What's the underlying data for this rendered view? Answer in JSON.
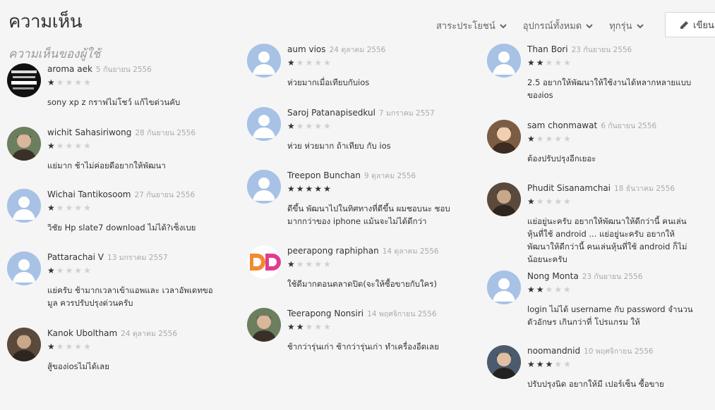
{
  "header": {
    "title": "ความเห็น",
    "filters": [
      "สาระประโยชน์",
      "อุปกรณ์ทั้งหมด",
      "ทุกรุ่น"
    ],
    "write_label": "เขียน",
    "subtitle": "ความเห็นของผู้ใช้"
  },
  "reviews": [
    {
      "name": "aroma aek",
      "date": "5 กันยายน 2556",
      "stars": 1,
      "text": "sony xp z กราฟไม่โชว์ แก้ไขด่วนคับ",
      "avatar": "logo-image"
    },
    {
      "name": "wichit Sahasiriwong",
      "date": "28 กันยายน 2556",
      "stars": 1,
      "text": "แย่มาก ช้าไม่ค่อยดีอยากให้พัฒนา",
      "avatar": "photo"
    },
    {
      "name": "Wichai Tantikosoom",
      "date": "27 กันยายน 2556",
      "stars": 1,
      "text": "วิชัย Hp slate7 download ไม่ได้?เซ็งเบย",
      "avatar": "default"
    },
    {
      "name": "Pattarachai V",
      "date": "13 มกราคม 2557",
      "stars": 1,
      "text": "แย่ครับ ช้ามากเวลาเข้าแอพและ เวลาอัพเดทขอมูล ควรปรับปรุงด่วนครับ",
      "avatar": "default"
    },
    {
      "name": "Kanok Uboltham",
      "date": "24 ตุลาคม 2556",
      "stars": 1,
      "text": "สู้ของiosไม่ได้เลย",
      "avatar": "photo"
    },
    {
      "name": "aum vios",
      "date": "24 ตุลาคม 2556",
      "stars": 1,
      "text": "ห่วยมากเมื่อเทียบกับios",
      "avatar": "default"
    },
    {
      "name": "Saroj Patanapisedkul",
      "date": "7 มกราคม 2557",
      "stars": 1,
      "text": "ห่วย ห่วยมาก ถ้าเทียบ กับ ios",
      "avatar": "default"
    },
    {
      "name": "Treepon Bunchan",
      "date": "9 ตุลาคม 2556",
      "stars": 5,
      "text": "ดีขึ้น พัฒนาไปในทิศทางที่ดีขึ้น ผมชอบนะ ชอบมากกว่าของ iphone แม้นจะไม่ได้ดีกว่า",
      "avatar": "default"
    },
    {
      "name": "peerapong raphiphan",
      "date": "14 ตุลาคม 2556",
      "stars": 1,
      "text": "ใช้ดีมากตอนตลาดปิด(จะให้ซื้อขายกับใคร)",
      "avatar": "dd-logo"
    },
    {
      "name": "Teerapong Nonsiri",
      "date": "14 พฤศจิกายน 2556",
      "stars": 2,
      "text": "ช้ากว่ารุ่นเก่า ช้ากว่ารุ่นเก่า ทำเครื่องอืดเลย",
      "avatar": "photo"
    },
    {
      "name": "Than Bori",
      "date": "23 กันยายน 2556",
      "stars": 2,
      "text": "2.5 อยากให้พัฒนาให้ใช้งานได้หลากหลายแบบของios",
      "avatar": "default"
    },
    {
      "name": "sam chonmawat",
      "date": "6 กันยายน 2556",
      "stars": 1,
      "text": "ต้องปรับปรุงอีกเยอะ",
      "avatar": "photo"
    },
    {
      "name": "Phudit Sisanamchai",
      "date": "18 ธันวาคม 2556",
      "stars": 1,
      "text": "แย่อยู่นะครับ อยากให้พัฒนาให้ดีกว่านี้ คนเล่นหุ้นที่ใช้ android ... แย่อยู่นะครับ อยากให้พัฒนาให้ดีกว่านี้ คนเล่นหุ้นที่ใช้ android ก็ไม่น้อยนะครับ",
      "avatar": "photo"
    },
    {
      "name": "Nong Monta",
      "date": "23 กันยายน 2556",
      "stars": 2,
      "text": "login ไม่ได้ username กับ password จำนวนตัวอักษร เกินกว่าที่ โปรแกรม ให้",
      "avatar": "default"
    },
    {
      "name": "noomandnid",
      "date": "10 พฤศจิกายน 2556",
      "stars": 3,
      "text": "ปรับปรุงนิด อยากให้มี เปอร์เซ็น ซื้อขาย",
      "avatar": "photo"
    }
  ]
}
